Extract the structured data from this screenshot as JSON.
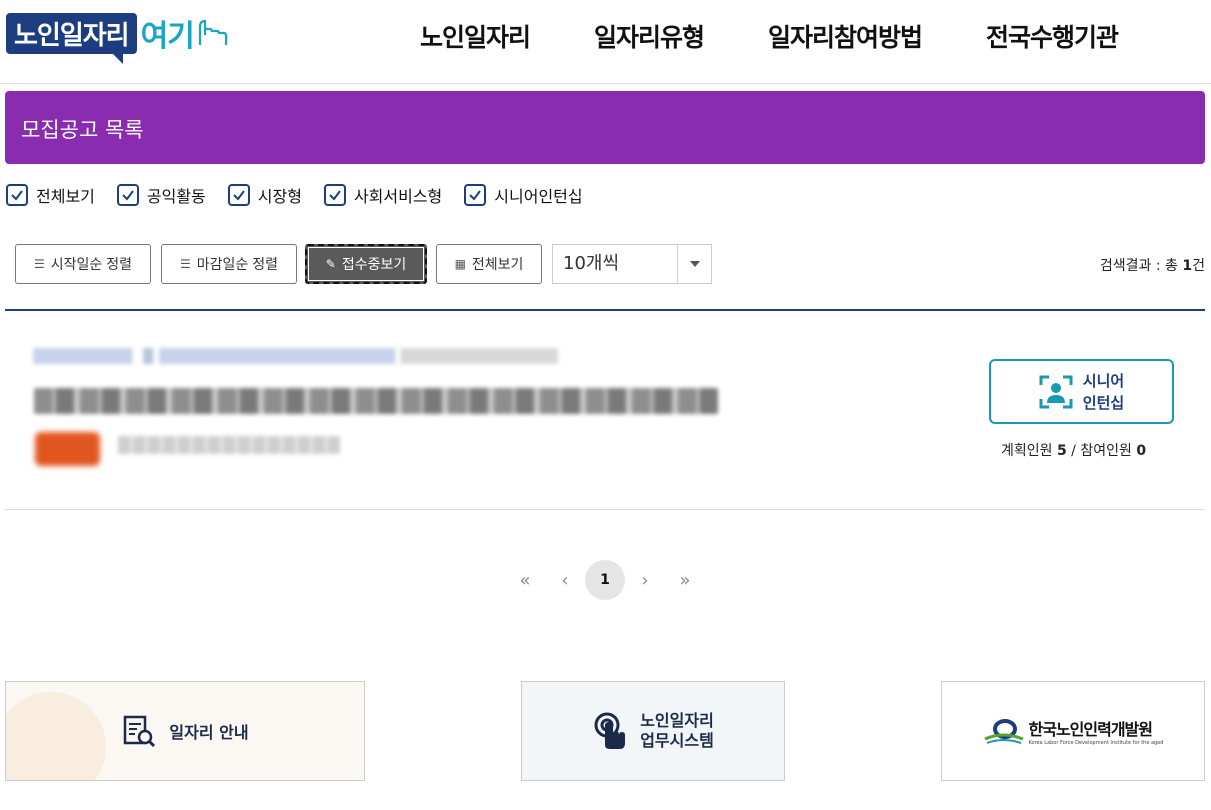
{
  "header": {
    "logo_main": "노인일자리",
    "logo_sub": "여기",
    "nav": [
      "노인일자리",
      "일자리유형",
      "일자리참여방법",
      "전국수행기관"
    ]
  },
  "title_bar": {
    "title": "모집공고 목록"
  },
  "filters": [
    {
      "label": "전체보기",
      "checked": true
    },
    {
      "label": "공익활동",
      "checked": true
    },
    {
      "label": "시장형",
      "checked": true
    },
    {
      "label": "사회서비스형",
      "checked": true
    },
    {
      "label": "시니어인턴십",
      "checked": true
    }
  ],
  "toolbar": {
    "sort_start": "시작일순 정렬",
    "sort_end": "마감일순 정렬",
    "open_only": "접수중보기",
    "view_all": "전체보기",
    "page_size": "10개씩",
    "result_prefix": "검색결과 : 총 ",
    "result_count": "1",
    "result_suffix": "건"
  },
  "listing": {
    "type_label_1": "시니어",
    "type_label_2": "인턴십",
    "planned_label": "계획인원 ",
    "planned_value": "5",
    "sep": " / ",
    "joined_label": "참여인원 ",
    "joined_value": "0"
  },
  "pagination": {
    "first": "«",
    "prev": "‹",
    "current": "1",
    "next": "›",
    "last": "»"
  },
  "footer": {
    "job_guide": "일자리 안내",
    "system_line1": "노인일자리",
    "system_line2": "업무시스템",
    "org_name": "한국노인인력개발원",
    "org_en": "Korea Labor Force Development Institute for the aged"
  },
  "colors": {
    "brand_navy": "#1c3d7f",
    "brand_teal": "#19a6c4",
    "title_purple": "#8a2cb0",
    "badge_orange": "#e1561f"
  }
}
